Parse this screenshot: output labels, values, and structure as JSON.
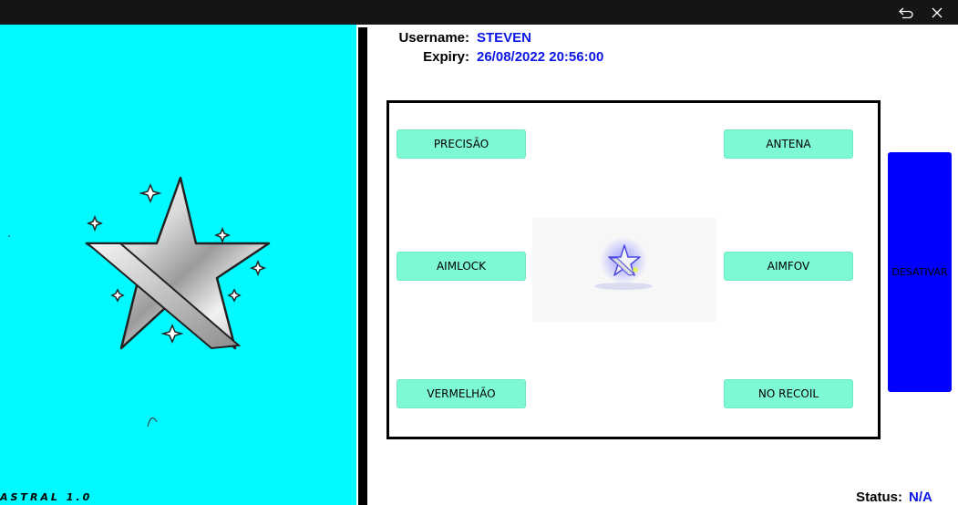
{
  "window": {
    "restore_icon": "back-arrow-icon",
    "close_icon": "close-icon"
  },
  "sidebar": {
    "version": "ASTRAL 1.0",
    "background": "#00faff"
  },
  "user": {
    "username_label": "Username:",
    "username": "STEVEN",
    "expiry_label": "Expiry:",
    "expiry": "26/08/2022 20:56:00"
  },
  "features": {
    "precision": "PRECISÃO",
    "antenna": "ANTENA",
    "aimlock": "AIMLOCK",
    "aimfov": "AIMFOV",
    "red": "VERMELHÃO",
    "no_recoil": "NO RECOIL",
    "button_color": "#7df9d3"
  },
  "deactivate": {
    "label": "DESATIVAR",
    "color": "#0000ff"
  },
  "status": {
    "label": "Status:",
    "value": "N/A"
  },
  "colors": {
    "accent_text": "#0c16e6",
    "titlebar": "#151515"
  }
}
